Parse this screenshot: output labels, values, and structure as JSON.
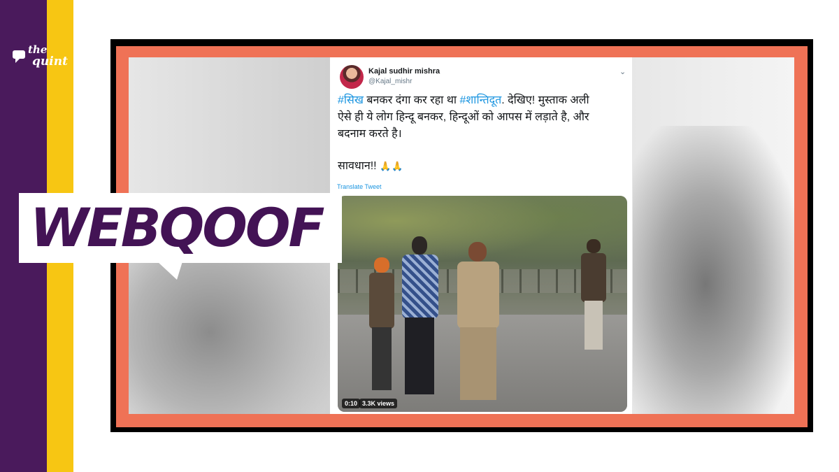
{
  "brand": {
    "logo_line1": "the",
    "logo_line2": "quint",
    "stripe_purple": "#4a1a5c",
    "stripe_yellow": "#f7c613",
    "frame_orange": "#ef7256"
  },
  "banner": {
    "label": "WEBQOOF",
    "text_color": "#431355"
  },
  "tweet": {
    "author_name": "Kajal sudhir mishra",
    "author_handle": "@Kajal_mishr",
    "menu_icon": "chevron-down-icon",
    "hashtag1": "#सिख",
    "text1": " बनकर दंगा कर रहा था ",
    "hashtag2": "#शान्तिदूत",
    "text2": ". देखिए! मुस्ताक अली",
    "line2": "ऐसे ही ये लोग हिन्दू बनकर, हिन्दूओं को आपस में लड़ाते है, और",
    "line3": "बदनाम करते है।",
    "warning": "सावधान!!",
    "emoji": "🙏🙏",
    "translate_link": "Translate Tweet",
    "hashtag_color": "#1b95e0",
    "video": {
      "duration": "0:10",
      "views": "3.3K views"
    }
  }
}
